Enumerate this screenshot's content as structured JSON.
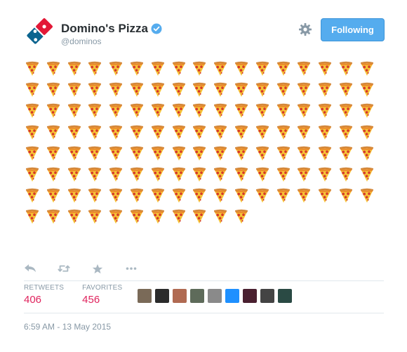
{
  "header": {
    "display_name": "Domino's Pizza",
    "handle": "@dominos",
    "follow_label": "Following",
    "verified": true
  },
  "tweet": {
    "emoji": "pizza",
    "emoji_count": 130,
    "columns": 17
  },
  "actions": [
    {
      "name": "reply-icon"
    },
    {
      "name": "retweet-icon"
    },
    {
      "name": "favorite-icon"
    },
    {
      "name": "more-icon"
    }
  ],
  "stats": {
    "retweets_label": "RETWEETS",
    "retweets_value": "406",
    "favorites_label": "FAVORITES",
    "favorites_value": "456"
  },
  "favoriters": [
    {
      "color": "#7a6a58"
    },
    {
      "color": "#2b2b2b"
    },
    {
      "color": "#b06a52"
    },
    {
      "color": "#5e6b5a"
    },
    {
      "color": "#8a8a8a"
    },
    {
      "color": "#1e90ff"
    },
    {
      "color": "#4a2030"
    },
    {
      "color": "#444444"
    },
    {
      "color": "#2a4a44"
    }
  ],
  "timestamp": "6:59 AM - 13 May 2015",
  "colors": {
    "accent": "#55acee",
    "count": "#e0245e",
    "muted": "#8899a6"
  }
}
